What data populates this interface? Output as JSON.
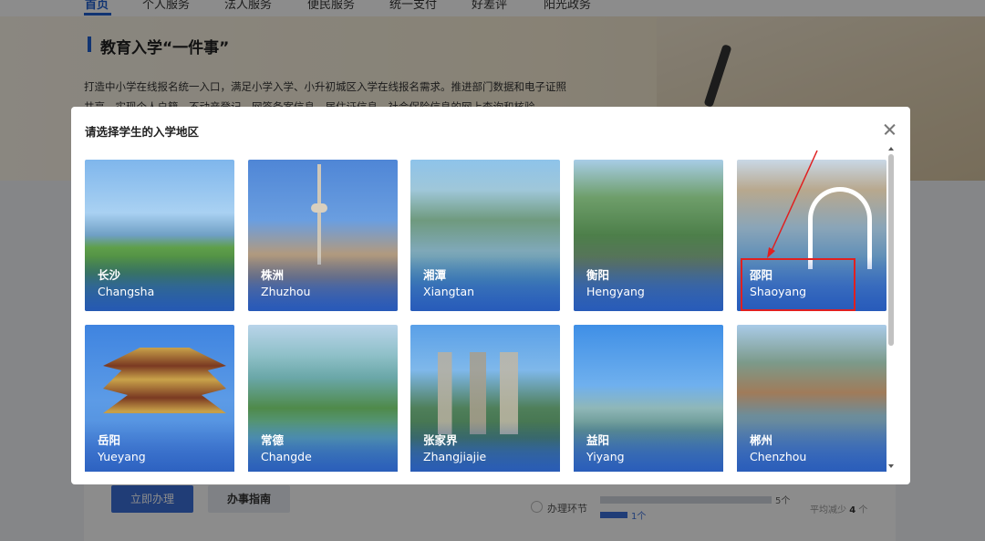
{
  "nav": {
    "items": [
      "首页",
      "个人服务",
      "法人服务",
      "便民服务",
      "统一支付",
      "好差评",
      "阳光政务"
    ]
  },
  "hero": {
    "title": "教育入学“一件事”",
    "desc_line1": "打造中小学在线报名统一入口，满足小学入学、小升初城区入学在线报名需求。推进部门数据和电子证照",
    "desc_line2": "共享，实现个人户籍、不动产登记、网签备案信息、居住证信息、社会保险信息的网上查询和核验。"
  },
  "actions": {
    "apply_label": "立即办理",
    "guide_label": "办事指南"
  },
  "stats": {
    "label": "办理环节",
    "top_value": "5个",
    "bottom_value": "1个",
    "avg_prefix": "平均减少",
    "avg_value": "4",
    "avg_suffix": "个"
  },
  "modal": {
    "title": "请选择学生的入学地区",
    "cities": [
      {
        "cn": "长沙",
        "en": "Changsha"
      },
      {
        "cn": "株洲",
        "en": "Zhuzhou"
      },
      {
        "cn": "湘潭",
        "en": "Xiangtan"
      },
      {
        "cn": "衡阳",
        "en": "Hengyang"
      },
      {
        "cn": "邵阳",
        "en": "Shaoyang"
      },
      {
        "cn": "岳阳",
        "en": "Yueyang"
      },
      {
        "cn": "常德",
        "en": "Changde"
      },
      {
        "cn": "张家界",
        "en": "Zhangjiajie"
      },
      {
        "cn": "益阳",
        "en": "Yiyang"
      },
      {
        "cn": "郴州",
        "en": "Chenzhou"
      }
    ]
  },
  "colors": {
    "accent": "#3b6fd9",
    "annotation": "#e02020"
  }
}
